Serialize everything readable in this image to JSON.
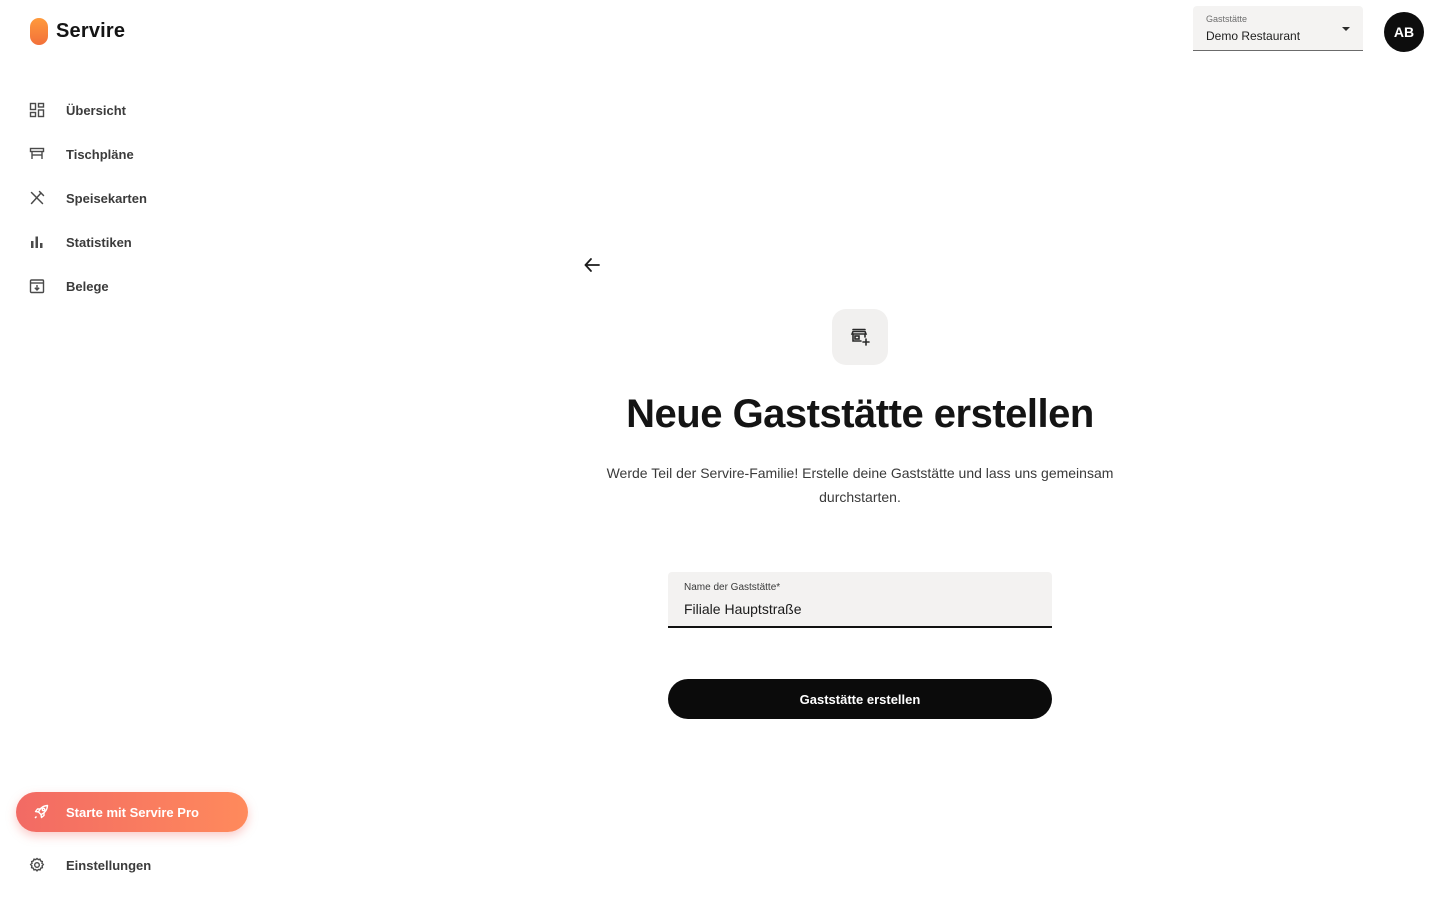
{
  "app": {
    "name": "Servire"
  },
  "sidebar": {
    "items": [
      {
        "label": "Übersicht",
        "icon": "dashboard-icon"
      },
      {
        "label": "Tischpläne",
        "icon": "table-icon"
      },
      {
        "label": "Speisekarten",
        "icon": "cutlery-icon"
      },
      {
        "label": "Statistiken",
        "icon": "bar-chart-icon"
      },
      {
        "label": "Belege",
        "icon": "receipt-archive-icon"
      }
    ],
    "pro_button": {
      "label": "Starte mit Servire Pro",
      "icon": "rocket-icon"
    },
    "settings": {
      "label": "Einstellungen",
      "icon": "gear-icon"
    }
  },
  "header": {
    "venue_select": {
      "label": "Gaststätte",
      "value": "Demo Restaurant"
    },
    "avatar_initials": "AB"
  },
  "main": {
    "heading": "Neue Gaststätte erstellen",
    "description": "Werde Teil der Servire-Familie! Erstelle deine Gaststätte und lass uns gemeinsam durchstarten.",
    "name_field": {
      "label": "Name der Gaststätte*",
      "value": "Filiale Hauptstraße"
    },
    "submit_label": "Gaststätte erstellen"
  },
  "colors": {
    "brand_orange": "#f2703a",
    "pro_gradient_start": "#f26a64",
    "pro_gradient_end": "#ff8a5c",
    "primary_dark": "#0b0b0b"
  }
}
